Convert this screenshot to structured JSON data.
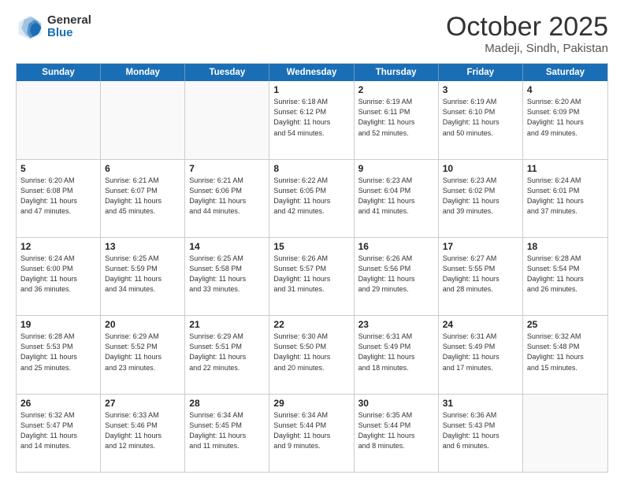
{
  "header": {
    "logo_general": "General",
    "logo_blue": "Blue",
    "month": "October 2025",
    "location": "Madeji, Sindh, Pakistan"
  },
  "days_of_week": [
    "Sunday",
    "Monday",
    "Tuesday",
    "Wednesday",
    "Thursday",
    "Friday",
    "Saturday"
  ],
  "weeks": [
    [
      {
        "day": "",
        "info": ""
      },
      {
        "day": "",
        "info": ""
      },
      {
        "day": "",
        "info": ""
      },
      {
        "day": "1",
        "info": "Sunrise: 6:18 AM\nSunset: 6:12 PM\nDaylight: 11 hours\nand 54 minutes."
      },
      {
        "day": "2",
        "info": "Sunrise: 6:19 AM\nSunset: 6:11 PM\nDaylight: 11 hours\nand 52 minutes."
      },
      {
        "day": "3",
        "info": "Sunrise: 6:19 AM\nSunset: 6:10 PM\nDaylight: 11 hours\nand 50 minutes."
      },
      {
        "day": "4",
        "info": "Sunrise: 6:20 AM\nSunset: 6:09 PM\nDaylight: 11 hours\nand 49 minutes."
      }
    ],
    [
      {
        "day": "5",
        "info": "Sunrise: 6:20 AM\nSunset: 6:08 PM\nDaylight: 11 hours\nand 47 minutes."
      },
      {
        "day": "6",
        "info": "Sunrise: 6:21 AM\nSunset: 6:07 PM\nDaylight: 11 hours\nand 45 minutes."
      },
      {
        "day": "7",
        "info": "Sunrise: 6:21 AM\nSunset: 6:06 PM\nDaylight: 11 hours\nand 44 minutes."
      },
      {
        "day": "8",
        "info": "Sunrise: 6:22 AM\nSunset: 6:05 PM\nDaylight: 11 hours\nand 42 minutes."
      },
      {
        "day": "9",
        "info": "Sunrise: 6:23 AM\nSunset: 6:04 PM\nDaylight: 11 hours\nand 41 minutes."
      },
      {
        "day": "10",
        "info": "Sunrise: 6:23 AM\nSunset: 6:02 PM\nDaylight: 11 hours\nand 39 minutes."
      },
      {
        "day": "11",
        "info": "Sunrise: 6:24 AM\nSunset: 6:01 PM\nDaylight: 11 hours\nand 37 minutes."
      }
    ],
    [
      {
        "day": "12",
        "info": "Sunrise: 6:24 AM\nSunset: 6:00 PM\nDaylight: 11 hours\nand 36 minutes."
      },
      {
        "day": "13",
        "info": "Sunrise: 6:25 AM\nSunset: 5:59 PM\nDaylight: 11 hours\nand 34 minutes."
      },
      {
        "day": "14",
        "info": "Sunrise: 6:25 AM\nSunset: 5:58 PM\nDaylight: 11 hours\nand 33 minutes."
      },
      {
        "day": "15",
        "info": "Sunrise: 6:26 AM\nSunset: 5:57 PM\nDaylight: 11 hours\nand 31 minutes."
      },
      {
        "day": "16",
        "info": "Sunrise: 6:26 AM\nSunset: 5:56 PM\nDaylight: 11 hours\nand 29 minutes."
      },
      {
        "day": "17",
        "info": "Sunrise: 6:27 AM\nSunset: 5:55 PM\nDaylight: 11 hours\nand 28 minutes."
      },
      {
        "day": "18",
        "info": "Sunrise: 6:28 AM\nSunset: 5:54 PM\nDaylight: 11 hours\nand 26 minutes."
      }
    ],
    [
      {
        "day": "19",
        "info": "Sunrise: 6:28 AM\nSunset: 5:53 PM\nDaylight: 11 hours\nand 25 minutes."
      },
      {
        "day": "20",
        "info": "Sunrise: 6:29 AM\nSunset: 5:52 PM\nDaylight: 11 hours\nand 23 minutes."
      },
      {
        "day": "21",
        "info": "Sunrise: 6:29 AM\nSunset: 5:51 PM\nDaylight: 11 hours\nand 22 minutes."
      },
      {
        "day": "22",
        "info": "Sunrise: 6:30 AM\nSunset: 5:50 PM\nDaylight: 11 hours\nand 20 minutes."
      },
      {
        "day": "23",
        "info": "Sunrise: 6:31 AM\nSunset: 5:49 PM\nDaylight: 11 hours\nand 18 minutes."
      },
      {
        "day": "24",
        "info": "Sunrise: 6:31 AM\nSunset: 5:49 PM\nDaylight: 11 hours\nand 17 minutes."
      },
      {
        "day": "25",
        "info": "Sunrise: 6:32 AM\nSunset: 5:48 PM\nDaylight: 11 hours\nand 15 minutes."
      }
    ],
    [
      {
        "day": "26",
        "info": "Sunrise: 6:32 AM\nSunset: 5:47 PM\nDaylight: 11 hours\nand 14 minutes."
      },
      {
        "day": "27",
        "info": "Sunrise: 6:33 AM\nSunset: 5:46 PM\nDaylight: 11 hours\nand 12 minutes."
      },
      {
        "day": "28",
        "info": "Sunrise: 6:34 AM\nSunset: 5:45 PM\nDaylight: 11 hours\nand 11 minutes."
      },
      {
        "day": "29",
        "info": "Sunrise: 6:34 AM\nSunset: 5:44 PM\nDaylight: 11 hours\nand 9 minutes."
      },
      {
        "day": "30",
        "info": "Sunrise: 6:35 AM\nSunset: 5:44 PM\nDaylight: 11 hours\nand 8 minutes."
      },
      {
        "day": "31",
        "info": "Sunrise: 6:36 AM\nSunset: 5:43 PM\nDaylight: 11 hours\nand 6 minutes."
      },
      {
        "day": "",
        "info": ""
      }
    ]
  ]
}
